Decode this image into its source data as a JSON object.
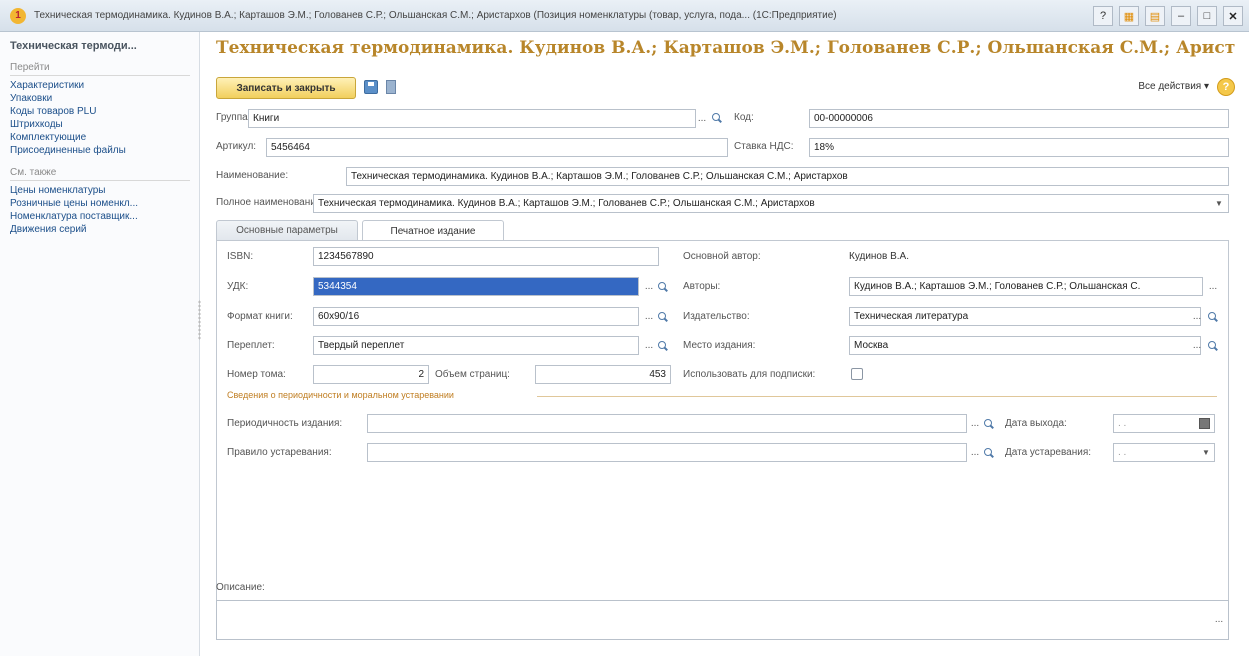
{
  "window": {
    "title": "Техническая термодинамика. Кудинов В.А.; Карташов Э.М.; Голованев С.Р.; Ольшанская С.М.; Аристархов (Позиция номенклатуры (товар, услуга, пода... (1С:Предприятие)",
    "app_icon": "1c-logo-icon"
  },
  "sidebar": {
    "title": "Техническая термоди...",
    "go_section": "Перейти",
    "go_items": [
      "Характеристики",
      "Упаковки",
      "Коды товаров PLU",
      "Штрихкоды",
      "Комплектующие",
      "Присоединенные файлы"
    ],
    "see_also_section": "См. также",
    "see_also_items": [
      "Цены номенклатуры",
      "Розничные цены номенкл...",
      "Номенклатура поставщик...",
      "Движения серий"
    ]
  },
  "header": {
    "doc_title": "Техническая термодинамика. Кудинов В.А.; Карташов Э.М.; Голованев С.Р.; Ольшанская С.М.; Аристархов (...",
    "save_close": "Записать и закрыть",
    "all_actions": "Все действия ▾"
  },
  "form": {
    "group_label": "Группа:",
    "group_value": "Книги",
    "code_label": "Код:",
    "code_value": "00-00000006",
    "article_label": "Артикул:",
    "article_value": "5456464",
    "vat_label": "Ставка НДС:",
    "vat_value": "18%",
    "name_label": "Наименование:",
    "name_value": "Техническая термодинамика. Кудинов В.А.; Карташов Э.М.; Голованев С.Р.; Ольшанская С.М.; Аристархов",
    "fullname_label": "Полное наименование:",
    "fullname_value": "Техническая термодинамика. Кудинов В.А.; Карташов Э.М.; Голованев С.Р.; Ольшанская С.М.; Аристархов"
  },
  "tabs": [
    {
      "label": "Основные параметры",
      "active": false
    },
    {
      "label": "Печатное издание",
      "active": true
    }
  ],
  "print": {
    "isbn_label": "ISBN:",
    "isbn_value": "1234567890",
    "udk_label": "УДК:",
    "udk_value": "5344354",
    "format_label": "Формат книги:",
    "format_value": "60х90/16",
    "binding_label": "Переплет:",
    "binding_value": "Твердый переплет",
    "volume_label": "Номер тома:",
    "volume_value": "2",
    "pages_label": "Объем страниц:",
    "pages_value": "453",
    "main_author_label": "Основной автор:",
    "main_author_value": "Кудинов В.А.",
    "authors_label": "Авторы:",
    "authors_value": "Кудинов В.А.; Карташов Э.М.; Голованев С.Р.; Ольшанская С.",
    "publisher_label": "Издательство:",
    "publisher_value": "Техническая литература",
    "place_label": "Место издания:",
    "place_value": "Москва",
    "subscription_label": "Использовать для подписки:",
    "subscription_checked": false,
    "periodicity_group": "Сведения о периодичности и моральном устаревании",
    "periodicity_label": "Периодичность издания:",
    "periodicity_value": "",
    "release_date_label": "Дата выхода:",
    "release_date_value": " .  .",
    "obsolescence_rule_label": "Правило устаревания:",
    "obsolescence_rule_value": "",
    "obsolescence_date_label": "Дата устаревания:",
    "obsolescence_date_value": " .  ."
  },
  "description": {
    "label": "Описание:",
    "value": ""
  },
  "accent_colors": {
    "title": "#b8862a",
    "save_button": "#f1cf5d",
    "selection": "#3468c2",
    "link": "#1c4f8a"
  }
}
